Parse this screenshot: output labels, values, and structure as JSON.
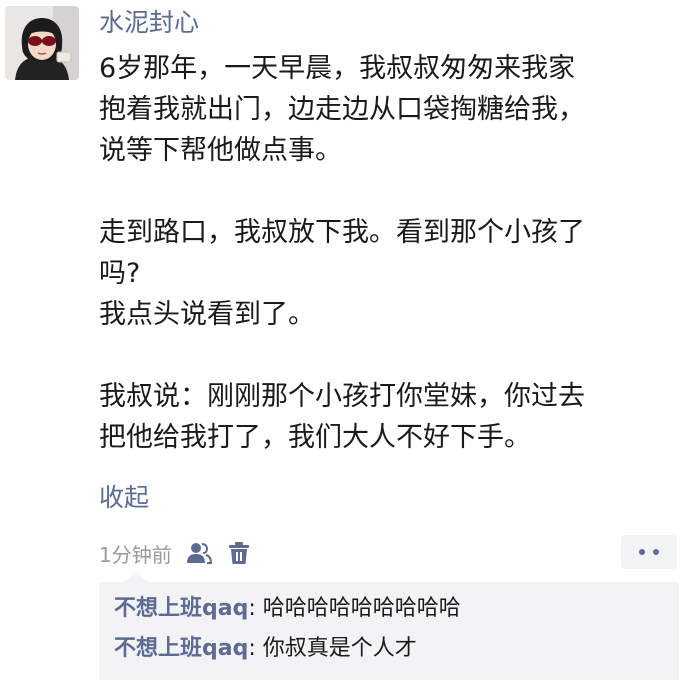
{
  "post": {
    "username": "水泥封心",
    "avatar_icon": "avatar-photo-sunglasses",
    "lines": [
      "6岁那年，一天早晨，我叔叔匆匆来我家",
      "抱着我就出门，边走边从口袋掏糖给我，",
      "说等下帮他做点事。",
      "",
      "走到路口，我叔放下我。看到那个小孩了",
      "吗?",
      "我点头说看到了。",
      "",
      "我叔说：刚刚那个小孩打你堂妹，你过去",
      "把他给我打了，我们大人不好下手。"
    ],
    "collapse_label": "收起",
    "timestamp": "1分钟前",
    "privacy_icon": "people-icon",
    "delete_icon": "trash-icon",
    "more_icon": "more-dots-icon"
  },
  "comments": [
    {
      "author": "不想上班qaq",
      "separator": ":",
      "text": "哈哈哈哈哈哈哈哈哈"
    },
    {
      "author": "不想上班qaq",
      "separator": ":",
      "text": "你叔真是个人才"
    }
  ],
  "colors": {
    "link": "#5b6b92",
    "text": "#1a1a1a",
    "muted": "#9a9a9a",
    "comment_bg": "#f3f3f5"
  }
}
